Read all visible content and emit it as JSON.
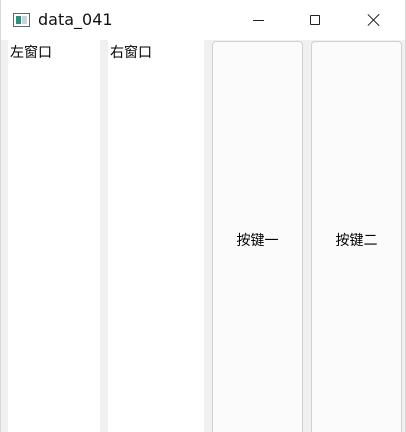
{
  "window": {
    "title": "data_041",
    "app_icon": "window-app-icon",
    "controls": {
      "minimize": "minimize-icon",
      "maximize": "maximize-icon",
      "close": "close-icon"
    }
  },
  "panels": {
    "left_label": "左窗口",
    "right_label": "右窗口"
  },
  "buttons": {
    "button_one": "按键一",
    "button_two": "按键二"
  },
  "colors": {
    "background": "#f0f0f0",
    "panel": "#ffffff",
    "button_face": "#fbfbfb",
    "button_border": "#d0d0d0"
  }
}
